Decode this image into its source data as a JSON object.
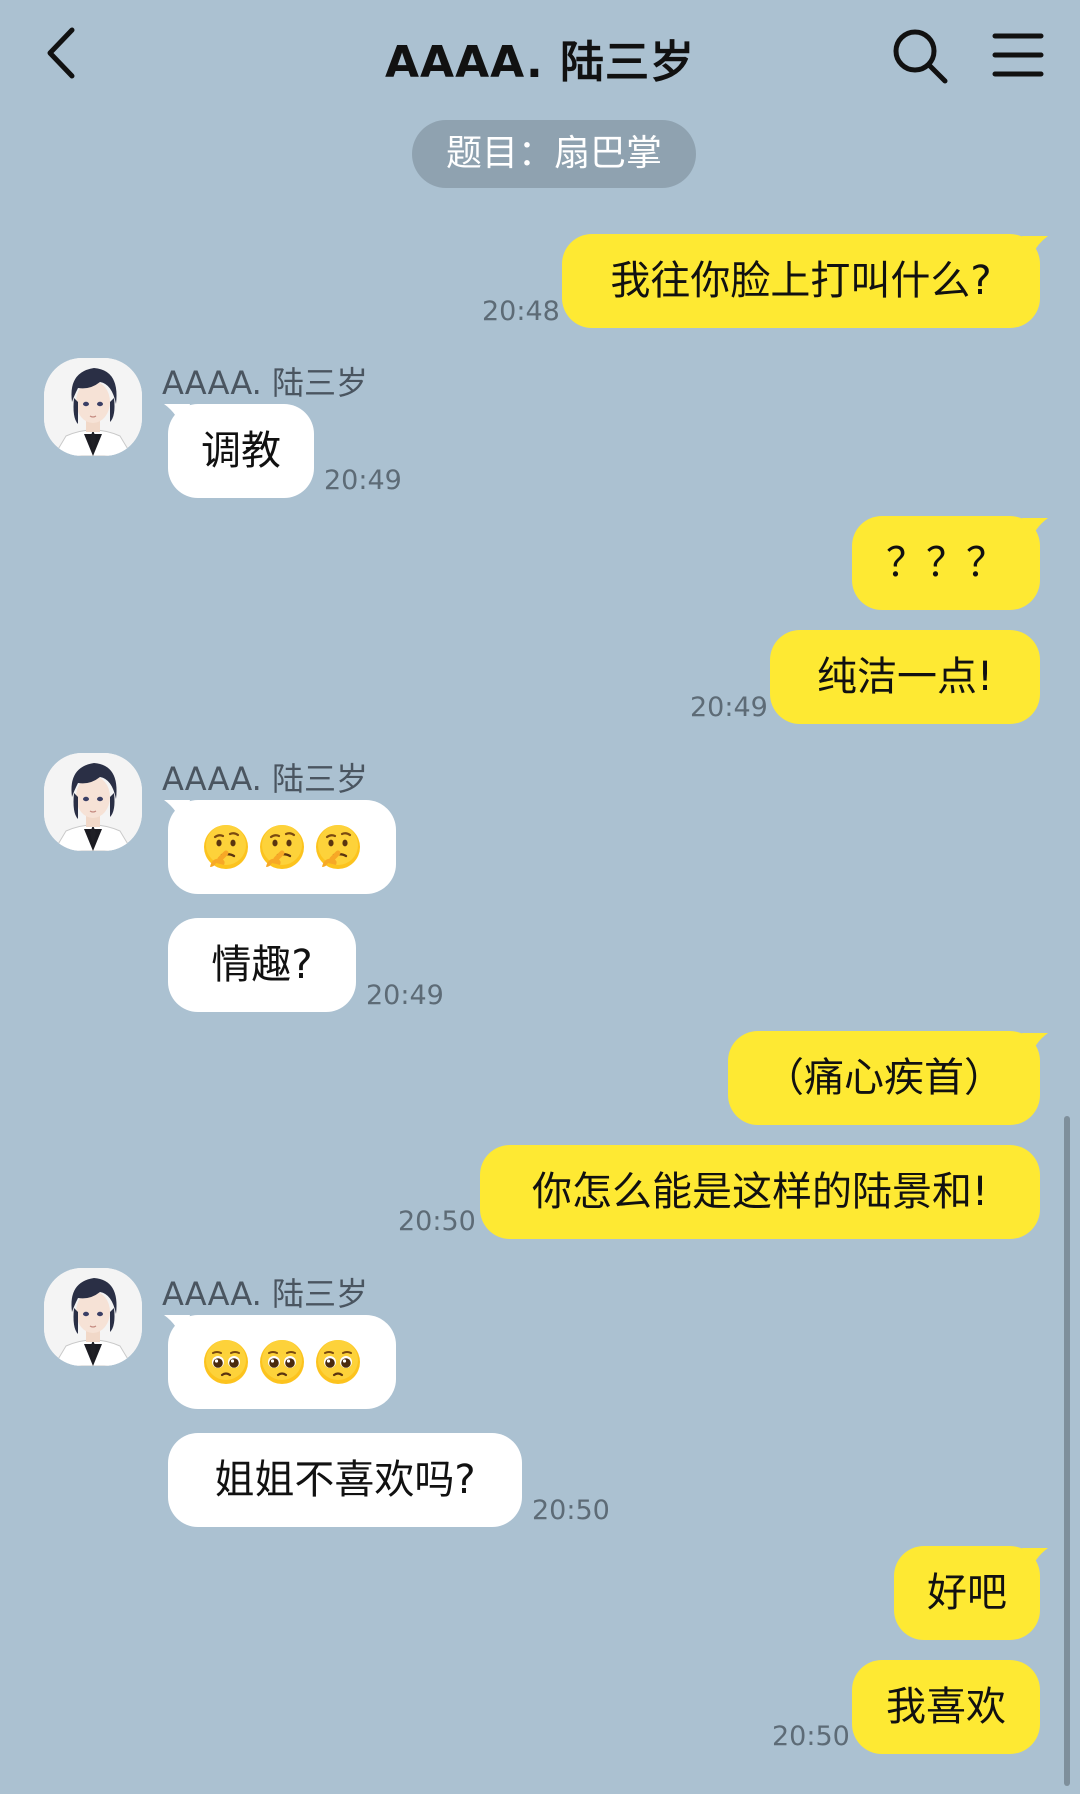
{
  "header": {
    "title": "AAAA. 陆三岁",
    "back_icon": "chevron-left-icon",
    "search_icon": "search-icon",
    "menu_icon": "hamburger-menu-icon"
  },
  "topic": "题目：扇巴掌",
  "colors": {
    "background": "#abc1d1",
    "my_bubble": "#fee933",
    "their_bubble": "#ffffff",
    "topic_pill": "#8fa2b0"
  },
  "contact_name": "AAAA. 陆三岁",
  "messages": [
    {
      "from": "me",
      "text": "我往你脸上打叫什么?",
      "time": "20:48"
    },
    {
      "from": "them",
      "text": "调教",
      "time": "20:49"
    },
    {
      "from": "me",
      "text": "？？？"
    },
    {
      "from": "me",
      "text": "纯洁一点!",
      "time": "20:49"
    },
    {
      "from": "them",
      "emoji": "thinking-face-emoji",
      "count": 3
    },
    {
      "from": "them",
      "text": "情趣?",
      "time": "20:49"
    },
    {
      "from": "me",
      "text": "（痛心疾首）"
    },
    {
      "from": "me",
      "text": "你怎么能是这样的陆景和!",
      "time": "20:50"
    },
    {
      "from": "them",
      "emoji": "pleading-face-emoji",
      "count": 3
    },
    {
      "from": "them",
      "text": "姐姐不喜欢吗?",
      "time": "20:50"
    },
    {
      "from": "me",
      "text": "好吧"
    },
    {
      "from": "me",
      "text": "我喜欢",
      "time": "20:50"
    }
  ]
}
